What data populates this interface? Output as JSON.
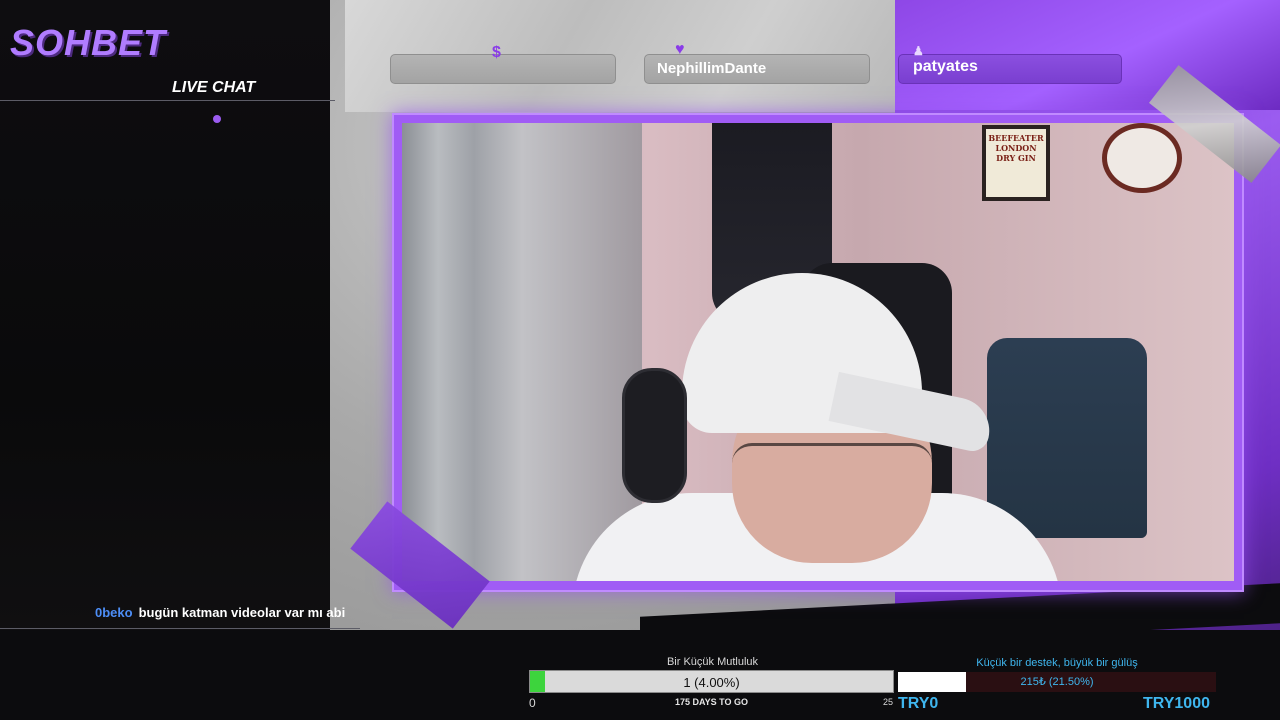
{
  "overlay": {
    "brand": "SOHBET",
    "live_chat_label": "LIVE CHAT"
  },
  "chat": {
    "messages": [
      {
        "user": "0beko",
        "text": "bugün katman videolar var mı abi"
      }
    ]
  },
  "alerts": [
    {
      "icon": "dollar-icon",
      "glyph": "$",
      "name": ""
    },
    {
      "icon": "heart-icon",
      "glyph": "♥",
      "name": "NephillimDante"
    },
    {
      "icon": "person-icon",
      "glyph": "♟",
      "name": "patyates"
    }
  ],
  "webcam": {
    "poster_text": "BEEFEATER LONDON DRY GIN"
  },
  "subscriber_goal": {
    "title": "Bir Küçük Mutluluk",
    "current": 1,
    "percent": 4.0,
    "value_label": "1 (4.00%)",
    "min_label": "0",
    "max_label": "25",
    "days_label": "175 DAYS TO GO"
  },
  "donation_goal": {
    "title": "Küçük bir destek, büyük bir gülüş",
    "percent": 21.5,
    "value_label": "215₺ (21.50%)",
    "min_label": "TRY0",
    "max_label": "TRY1000"
  },
  "colors": {
    "accent_purple": "#9b5cf0",
    "chat_user": "#4d8ef7",
    "goal_fill": "#3dd43d",
    "donation_text": "#3fb6ee"
  }
}
